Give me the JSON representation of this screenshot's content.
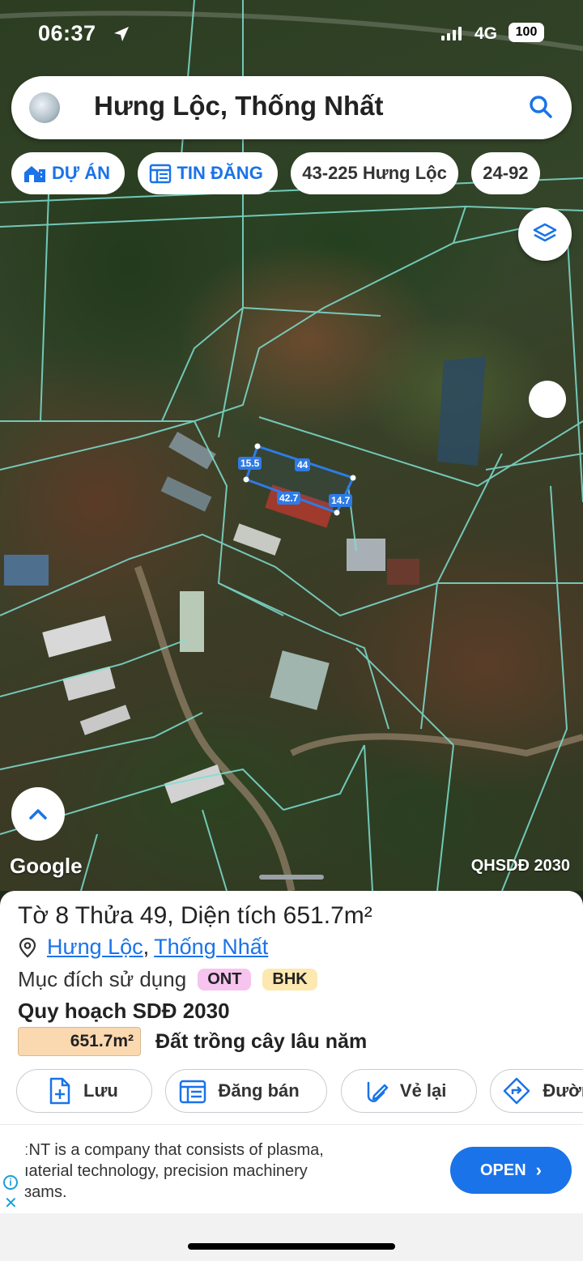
{
  "status_bar": {
    "time": "06:37",
    "network": "4G",
    "battery": "100"
  },
  "search": {
    "title": "Hưng Lộc, Thống Nhất",
    "search_icon": "search-icon"
  },
  "chips": [
    {
      "label": "DỰ ÁN",
      "icon": "house-icon"
    },
    {
      "label": "TIN ĐĂNG",
      "icon": "listing-icon"
    },
    {
      "label": "43-225 Hưng Lộc"
    },
    {
      "label": "24-92"
    }
  ],
  "map": {
    "measurements": [
      "15.5",
      "44",
      "42.7",
      "14.7"
    ],
    "attribution": "Google",
    "plan_layer": "QHSDĐ 2030",
    "layers_icon": "layers-icon",
    "up_icon": "chevron-up-icon"
  },
  "parcel": {
    "title": "Tờ 8 Thửa 49, Diện tích 651.7m²",
    "ward": "Hưng Lộc",
    "district": "Thống Nhất",
    "purpose_label": "Mục đích sử dụng",
    "purpose_codes": [
      "ONT",
      "BHK"
    ],
    "plan_title": "Quy hoạch SDĐ 2030",
    "area": "651.7m²",
    "land_type": "Đất trồng cây lâu năm"
  },
  "actions": [
    {
      "label": "Lưu",
      "icon": "add-file-icon"
    },
    {
      "label": "Đăng bán",
      "icon": "calendar-icon"
    },
    {
      "label": "Vẻ lại",
      "icon": "pencil-icon"
    },
    {
      "label": "Đườn",
      "icon": "directions-icon"
    }
  ],
  "ad": {
    "lines": [
      "ːNT is a company that consists of plasma,",
      "ıaterial technology, precision machinery",
      "ɜams."
    ],
    "cta": "OPEN",
    "cta_chevron": "›"
  },
  "colors": {
    "accent": "#1a73e8",
    "parcel_outline": "#2f7be6",
    "boundary_lines": "#7ee0d2",
    "ont_badge": "#f6c4ee",
    "bhk_badge": "#fde9b0",
    "area_fill": "#fbd9b0"
  }
}
